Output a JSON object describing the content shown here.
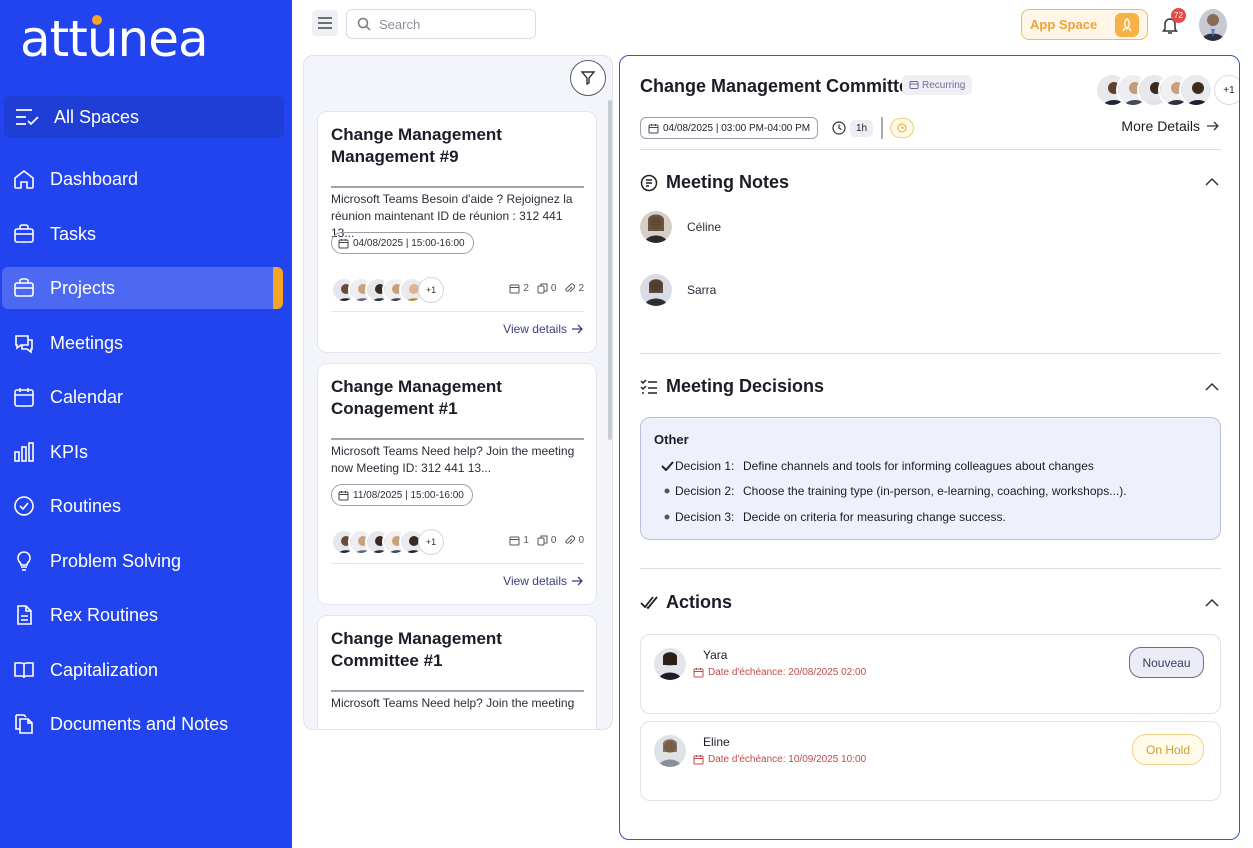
{
  "app": {
    "logo": "attunea"
  },
  "sidebar": {
    "all_spaces": "All Spaces",
    "items": [
      {
        "label": "Dashboard",
        "icon": "home-icon"
      },
      {
        "label": "Tasks",
        "icon": "briefcase-icon"
      },
      {
        "label": "Projects",
        "icon": "folder-icon",
        "active": true
      },
      {
        "label": "Meetings",
        "icon": "chat-icon"
      },
      {
        "label": "Calendar",
        "icon": "calendar-icon"
      },
      {
        "label": "KPIs",
        "icon": "bar-chart-icon"
      },
      {
        "label": "Routines",
        "icon": "check-circle-icon"
      },
      {
        "label": "Problem Solving",
        "icon": "lightbulb-icon"
      },
      {
        "label": "Rex Routines",
        "icon": "document-icon"
      },
      {
        "label": "Capitalization",
        "icon": "book-icon"
      },
      {
        "label": "Documents and Notes",
        "icon": "files-icon"
      }
    ]
  },
  "topbar": {
    "search_placeholder": "Search",
    "app_space": "App Space",
    "notifications_count": "72"
  },
  "meetings_list": [
    {
      "title": "Change Management Management #9",
      "description": "Microsoft Teams Besoin d'aide ? Rejoignez la réunion maintenant ID de réunion : 312 441 13...",
      "date": "04/08/2025 | 15:00-16:00",
      "more_participants": "+1",
      "stats": [
        "2",
        "0",
        "2"
      ],
      "link": "View details"
    },
    {
      "title": "Change Management Conagement #1",
      "description": "Microsoft Teams Need help? Join the meeting now Meeting ID: 312 441 13...",
      "date": "11/08/2025 | 15:00-16:00",
      "more_participants": "+1",
      "stats": [
        "1",
        "0",
        "0"
      ],
      "link": "View details"
    },
    {
      "title": "Change Management Committee #1",
      "description": "Microsoft Teams Need help? Join the meeting",
      "date": "",
      "more_participants": "",
      "stats": [
        "",
        "",
        ""
      ],
      "link": ""
    }
  ],
  "detail": {
    "title": "Change Management Committee",
    "recurring": "Recurring",
    "more_participants": "+1",
    "date": "04/08/2025 | 03:00 PM-04:00 PM",
    "duration": "1h",
    "more_details": "More Details",
    "notes_title": "Meeting Notes",
    "notes": [
      {
        "name": "Céline"
      },
      {
        "name": "Sarra"
      }
    ],
    "decisions_title": "Meeting Decisions",
    "decisions_group": "Other",
    "decisions": [
      {
        "label": "Decision 1:",
        "text": "Define channels and tools for informing colleagues about changes",
        "done": true
      },
      {
        "label": "Decision 2:",
        "text": "Choose the training type (in-person, e-learning, coaching, workshops...).",
        "done": false
      },
      {
        "label": "Decision 3:",
        "text": "Decide on criteria for measuring change success.",
        "done": false
      }
    ],
    "actions_title": "Actions",
    "actions": [
      {
        "name": "Yara",
        "due": "Date d'échéance: 20/08/2025 02:00",
        "status": "Nouveau"
      },
      {
        "name": "Eline",
        "due": "Date d'échéance: 10/09/2025 10:00",
        "status": "On Hold"
      }
    ]
  },
  "colors": {
    "sidebar": "#2244ee",
    "accent": "#f5a524",
    "active_nav": "#4d69f2"
  }
}
